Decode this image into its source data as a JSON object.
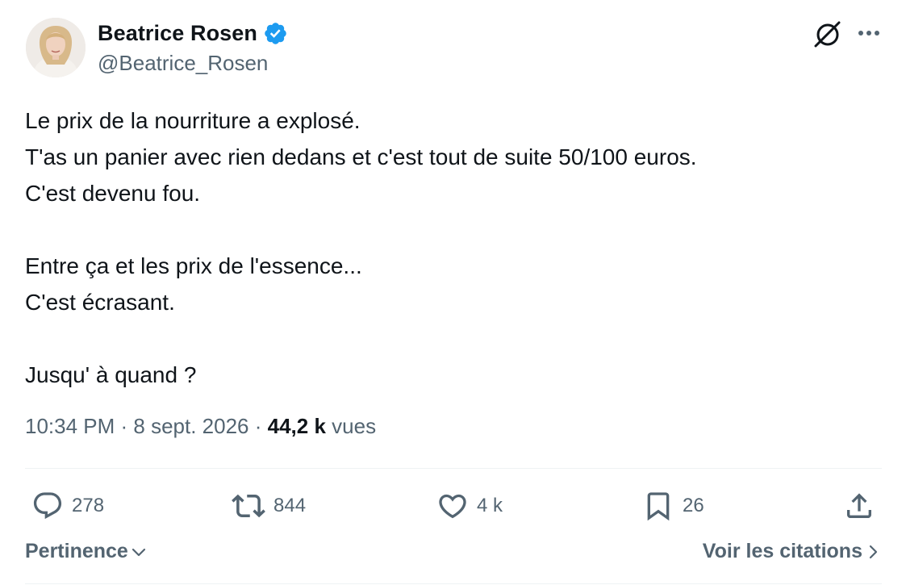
{
  "author": {
    "display_name": "Beatrice Rosen",
    "handle": "@Beatrice_Rosen",
    "verified": true,
    "verified_color": "#1d9bf0",
    "avatar_icon": "profile-photo"
  },
  "header_icons": {
    "grok": "grok-icon",
    "more": "more-options-icon"
  },
  "tweet": {
    "lines": [
      "Le prix de la nourriture a explosé.",
      "T'as un panier avec rien dedans et c'est tout de suite 50/100 euros.",
      "C'est devenu fou.",
      "",
      "Entre ça et les prix de l'essence...",
      "C'est écrasant.",
      "",
      "Jusqu' à quand ?"
    ]
  },
  "meta": {
    "time": "10:34 PM",
    "separator": " · ",
    "date": "8 sept. 2026",
    "views_count": "44,2 k",
    "views_label": "vues"
  },
  "actions": {
    "replies": "278",
    "reposts": "844",
    "likes": "4 k",
    "bookmarks": "26"
  },
  "footer": {
    "sort_label": "Pertinence",
    "quotes_label": "Voir les citations"
  },
  "colors": {
    "text_primary": "#0f1419",
    "text_secondary": "#536471",
    "divider": "#eff3f4",
    "accent": "#1d9bf0"
  }
}
